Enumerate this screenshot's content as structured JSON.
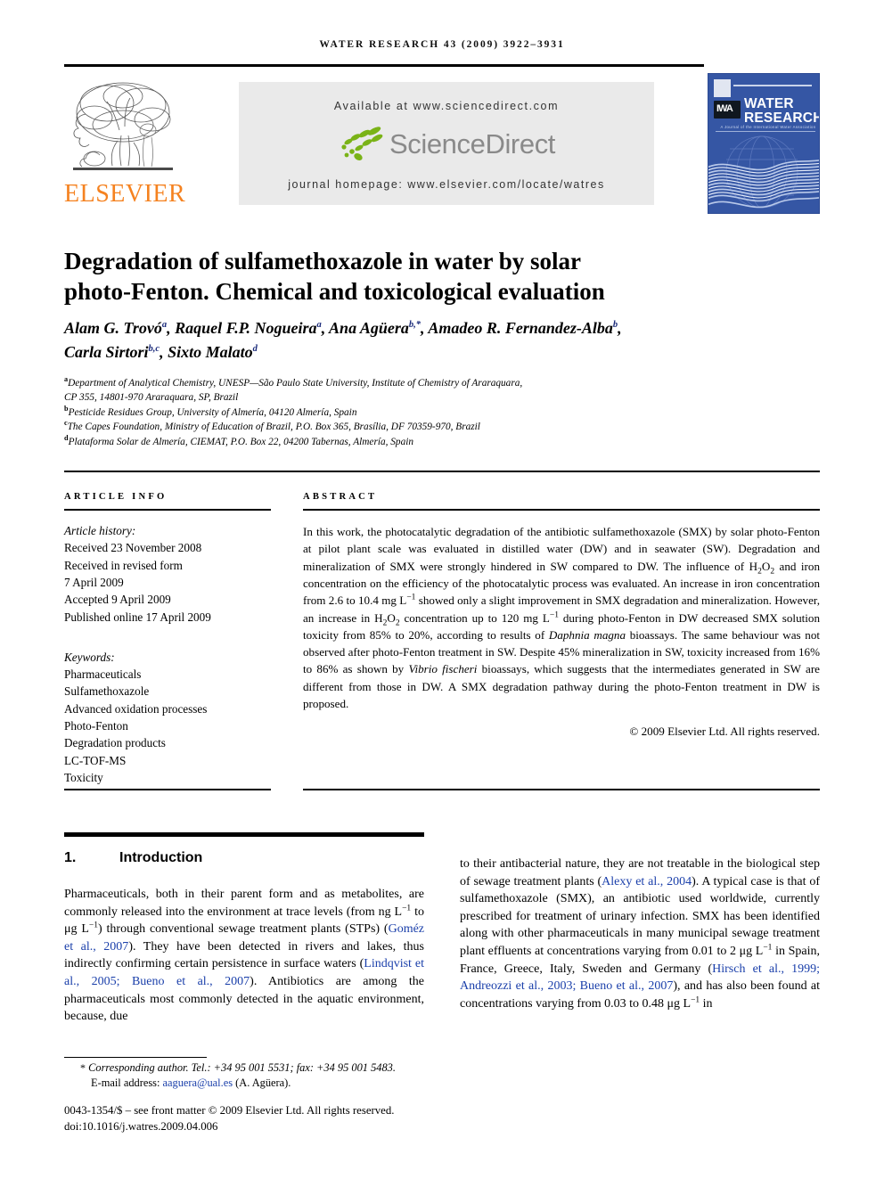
{
  "running_head": "WATER RESEARCH 43 (2009) 3922–3931",
  "masthead": {
    "available_at": "Available at www.sciencedirect.com",
    "sciencedirect_wordmark": "ScienceDirect",
    "journal_homepage": "journal homepage: www.elsevier.com/locate/watres",
    "publisher_wordmark": "ELSEVIER",
    "cover": {
      "iwa_badge": "IWA",
      "title_line1": "WATER",
      "title_line2": "RESEARCH",
      "subtitle": "A Journal of the International Water Association"
    }
  },
  "article": {
    "title_line1": "Degradation of sulfamethoxazole in water by solar",
    "title_line2": "photo-Fenton. Chemical and toxicological evaluation",
    "authors": [
      {
        "name": "Alam G. Trovó",
        "sup": "a",
        "sep": ", "
      },
      {
        "name": "Raquel F.P. Nogueira",
        "sup": "a",
        "sep": ", "
      },
      {
        "name": "Ana Agüera",
        "sup": "b,*",
        "sep": ", "
      },
      {
        "name": "Amadeo R. Fernandez-Alba",
        "sup": "b",
        "sep": ", "
      },
      {
        "name": "Carla Sirtori",
        "sup": "b,c",
        "sep": ", "
      },
      {
        "name": "Sixto Malato",
        "sup": "d",
        "sep": ""
      }
    ],
    "affiliations": [
      {
        "sup": "a",
        "text": "Department of Analytical Chemistry, UNESP—São Paulo State University, Institute of Chemistry of Araraquara,"
      },
      {
        "sup": "",
        "text": "CP 355, 14801-970 Araraquara, SP, Brazil"
      },
      {
        "sup": "b",
        "text": "Pesticide Residues Group, University of Almería, 04120 Almería, Spain"
      },
      {
        "sup": "c",
        "text": "The Capes Foundation, Ministry of Education of Brazil, P.O. Box 365, Brasília, DF 70359-970, Brazil"
      },
      {
        "sup": "d",
        "text": "Plataforma Solar de Almería, CIEMAT, P.O. Box 22, 04200 Tabernas, Almería, Spain"
      }
    ]
  },
  "article_info": {
    "label": "ARTICLE INFO",
    "history_label": "Article history:",
    "history": [
      "Received 23 November 2008",
      "Received in revised form",
      "7 April 2009",
      "Accepted 9 April 2009",
      "Published online 17 April 2009"
    ],
    "keywords_label": "Keywords:",
    "keywords": [
      "Pharmaceuticals",
      "Sulfamethoxazole",
      "Advanced oxidation processes",
      "Photo-Fenton",
      "Degradation products",
      "LC-TOF-MS",
      "Toxicity"
    ]
  },
  "abstract": {
    "label": "ABSTRACT",
    "copyright": "© 2009 Elsevier Ltd. All rights reserved."
  },
  "introduction": {
    "number": "1.",
    "heading": "Introduction"
  },
  "footer": {
    "corresponding_marker": "*",
    "corresponding": "Corresponding author. Tel.: +34 95 001 5531; fax: +34 95 001 5483.",
    "email_label": "E-mail address:",
    "email": "aaguera@ual.es",
    "email_suffix": "(A. Agüera).",
    "frontmatter": "0043-1354/$ – see front matter © 2009 Elsevier Ltd. All rights reserved.",
    "doi": "doi:10.1016/j.watres.2009.04.006"
  },
  "colors": {
    "link": "#1a3faa",
    "elsevier_orange": "#F58220",
    "cover_blue": "#3556a4",
    "band_gray": "#eaeaea",
    "sciencedirect_green": "#7ab317"
  }
}
